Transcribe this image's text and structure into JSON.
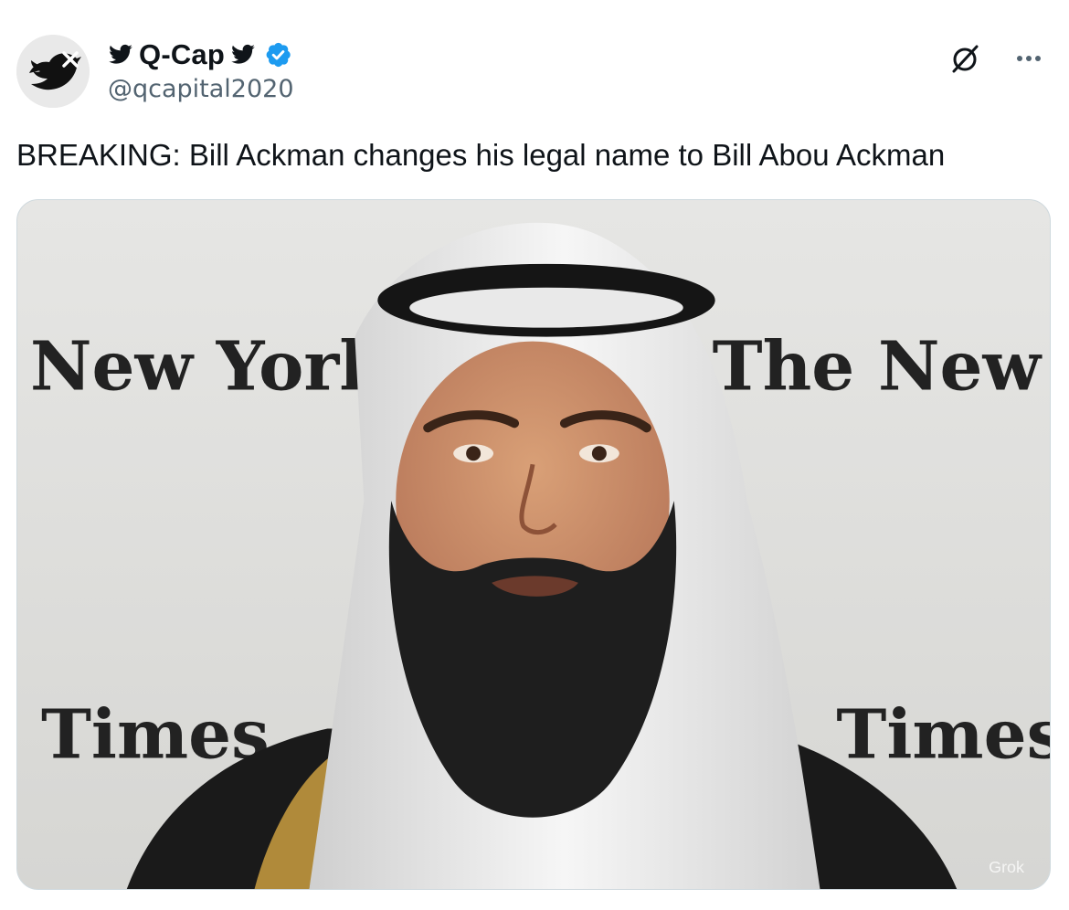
{
  "author": {
    "display_name": "Q-Cap",
    "handle": "@qcapital2020",
    "verified": true,
    "avatar_icon": "twitter-bird-x-avatar"
  },
  "tweet": {
    "text": "BREAKING: Bill Ackman changes his legal name to Bill Abou Ackman"
  },
  "actions": {
    "grok_icon": "grok-slash-icon",
    "more_icon": "more-dots-icon"
  },
  "media": {
    "backdrop_text_left_top": "New York T",
    "backdrop_text_right_top": "The New Yo",
    "backdrop_text_left_bottom": "Times",
    "backdrop_text_right_bottom": "Times",
    "watermark": "Grok"
  },
  "colors": {
    "verified_blue": "#1d9bf0",
    "handle_gray": "#536471",
    "text": "#0f1419"
  }
}
